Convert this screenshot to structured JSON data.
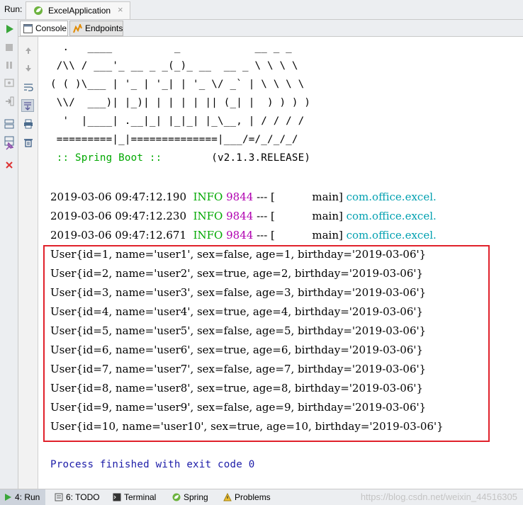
{
  "titlebar": {
    "run_label": "Run:",
    "tab_title": "ExcelApplication",
    "tab_close": "×"
  },
  "subtabs": {
    "console": "Console",
    "endpoints": "Endpoints"
  },
  "banner": {
    "l1": "  .   ____          _            __ _ _",
    "l2": " /\\\\ / ___'_ __ _ _(_)_ __  __ _ \\ \\ \\ \\",
    "l3": "( ( )\\___ | '_ | '_| | '_ \\/ _` | \\ \\ \\ \\",
    "l4": " \\\\/  ___)| |_)| | | | | || (_| |  ) ) ) )",
    "l5": "  '  |____| .__|_| |_|_| |_\\__, | / / / /",
    "l6": " =========|_|==============|___/=/_/_/_/",
    "spring": " :: Spring Boot :: ",
    "version": "       (v2.1.3.RELEASE)"
  },
  "logs": [
    {
      "ts": "2019-03-06 09:47:12.190",
      "level": "INFO",
      "pid": "9844",
      "sep": " --- [",
      "thread": "           main]",
      "logger": "com.office.excel."
    },
    {
      "ts": "2019-03-06 09:47:12.230",
      "level": "INFO",
      "pid": "9844",
      "sep": " --- [",
      "thread": "           main]",
      "logger": "com.office.excel."
    },
    {
      "ts": "2019-03-06 09:47:12.671",
      "level": "INFO",
      "pid": "9844",
      "sep": " --- [",
      "thread": "           main]",
      "logger": "com.office.excel."
    }
  ],
  "users": [
    "User{id=1, name='user1', sex=false, age=1, birthday='2019-03-06'}",
    "User{id=2, name='user2', sex=true, age=2, birthday='2019-03-06'}",
    "User{id=3, name='user3', sex=false, age=3, birthday='2019-03-06'}",
    "User{id=4, name='user4', sex=true, age=4, birthday='2019-03-06'}",
    "User{id=5, name='user5', sex=false, age=5, birthday='2019-03-06'}",
    "User{id=6, name='user6', sex=true, age=6, birthday='2019-03-06'}",
    "User{id=7, name='user7', sex=false, age=7, birthday='2019-03-06'}",
    "User{id=8, name='user8', sex=true, age=8, birthday='2019-03-06'}",
    "User{id=9, name='user9', sex=false, age=9, birthday='2019-03-06'}",
    "User{id=10, name='user10', sex=true, age=10, birthday='2019-03-06'}"
  ],
  "exit_message": "Process finished with exit code 0",
  "statusbar": {
    "run": "4: Run",
    "todo": "6: TODO",
    "terminal": "Terminal",
    "spring": "Spring",
    "problems": "Problems",
    "watermark": "https://blog.csdn.net/weixin_44516305"
  },
  "colors": {
    "highlight_box": "#e0212b",
    "info": "#00a800",
    "pid": "#b000b0",
    "logger": "#00a0b0",
    "exit": "#1c1ca8"
  }
}
